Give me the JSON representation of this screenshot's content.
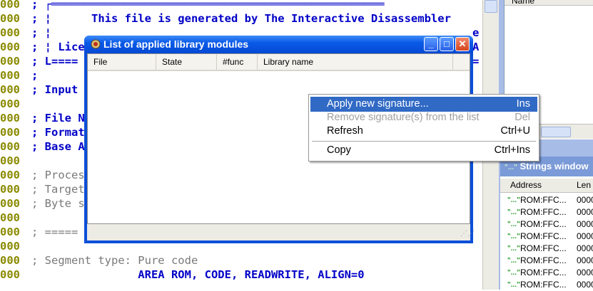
{
  "disasm": {
    "lines": [
      {
        "addr": "000",
        "text": "; ┌══════════════════════════════════════════════════",
        "cls": "c-blue"
      },
      {
        "addr": "000",
        "text": "; ¦      This file is generated by The Interactive Disassembler",
        "cls": "c-blue"
      },
      {
        "addr": "000",
        "text": "; ¦",
        "cls": "c-blue"
      },
      {
        "addr": "000",
        "text": "; ¦ Lice",
        "cls": "c-blue"
      },
      {
        "addr": "000",
        "text": "; L====",
        "cls": "c-blue"
      },
      {
        "addr": "000",
        "text": ";",
        "cls": "c-blue"
      },
      {
        "addr": "000",
        "text": "; Input",
        "cls": "c-blue"
      },
      {
        "addr": "000",
        "text": "",
        "cls": "c-blue"
      },
      {
        "addr": "000",
        "text": "; File N",
        "cls": "c-blue"
      },
      {
        "addr": "000",
        "text": "; Format",
        "cls": "c-blue"
      },
      {
        "addr": "000",
        "text": "; Base A",
        "cls": "c-blue"
      },
      {
        "addr": "000",
        "text": "",
        "cls": "c-blue"
      },
      {
        "addr": "000",
        "text": "; Proces",
        "cls": "c-gray"
      },
      {
        "addr": "000",
        "text": "; Target",
        "cls": "c-gray"
      },
      {
        "addr": "000",
        "text": "; Byte s",
        "cls": "c-gray"
      },
      {
        "addr": "000",
        "text": "",
        "cls": "c-gray"
      },
      {
        "addr": "000",
        "text": "; =====",
        "cls": "c-gray"
      },
      {
        "addr": "000",
        "text": "",
        "cls": "c-gray"
      },
      {
        "addr": "000",
        "text": "; Segment type: Pure code",
        "cls": "c-gray"
      },
      {
        "addr": "000",
        "text": "                AREA ROM, CODE, READWRITE, ALIGN=0",
        "cls": "c-blue"
      }
    ],
    "right_edge_chars": [
      "e",
      "A",
      "="
    ]
  },
  "names_panel": {
    "header": "Name"
  },
  "strings_window": {
    "title": "Strings window",
    "columns": [
      "Address",
      "Len"
    ],
    "icon": "\"...\"",
    "rows": [
      {
        "address": "ROM:FFC...",
        "len": "0000"
      },
      {
        "address": "ROM:FFC...",
        "len": "0000"
      },
      {
        "address": "ROM:FFC...",
        "len": "0000"
      },
      {
        "address": "ROM:FFC...",
        "len": "0000"
      },
      {
        "address": "ROM:FFC...",
        "len": "0000"
      },
      {
        "address": "ROM:FFC...",
        "len": "0000"
      },
      {
        "address": "ROM:FFC...",
        "len": "0000"
      },
      {
        "address": "ROM:FFC...",
        "len": "0000"
      }
    ]
  },
  "dialog": {
    "title": "List of applied library modules",
    "columns": [
      "File",
      "State",
      "#func",
      "Library name"
    ],
    "buttons": {
      "minimize": "_",
      "maximize": "□",
      "close": "✕"
    }
  },
  "context_menu": {
    "items": [
      {
        "label": "Apply new signature...",
        "shortcut": "Ins",
        "state": "selected"
      },
      {
        "label": "Remove signature(s) from the list",
        "shortcut": "Del",
        "state": "disabled"
      },
      {
        "label": "Refresh",
        "shortcut": "Ctrl+U",
        "state": "normal"
      },
      {
        "label": "Copy",
        "shortcut": "Ctrl+Ins",
        "state": "normal"
      }
    ]
  },
  "colors": {
    "address": "#8a8a00",
    "comment_blue": "#0000c8",
    "comment_gray": "#7a7a7a",
    "title_blue": "#0a5ae8",
    "menu_highlight": "#316ac5"
  }
}
